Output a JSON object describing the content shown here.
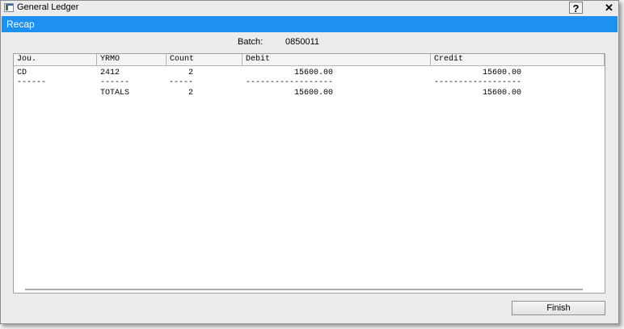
{
  "window": {
    "title": "General Ledger",
    "help_label": "?",
    "close_label": "✕"
  },
  "header": {
    "title": "Recap"
  },
  "batch": {
    "label": "Batch:",
    "value": "0850011"
  },
  "grid": {
    "columns": [
      "Jou.",
      "YRMO",
      "Count",
      "Debit",
      "Credit"
    ],
    "rows": [
      [
        "CD",
        "2412",
        "2",
        "15600.00",
        "15600.00"
      ],
      [
        "------",
        "------",
        "-----",
        "------------------",
        "------------------"
      ],
      [
        "",
        "TOTALS",
        "2",
        "15600.00",
        "15600.00"
      ]
    ]
  },
  "buttons": {
    "finish": "Finish"
  }
}
